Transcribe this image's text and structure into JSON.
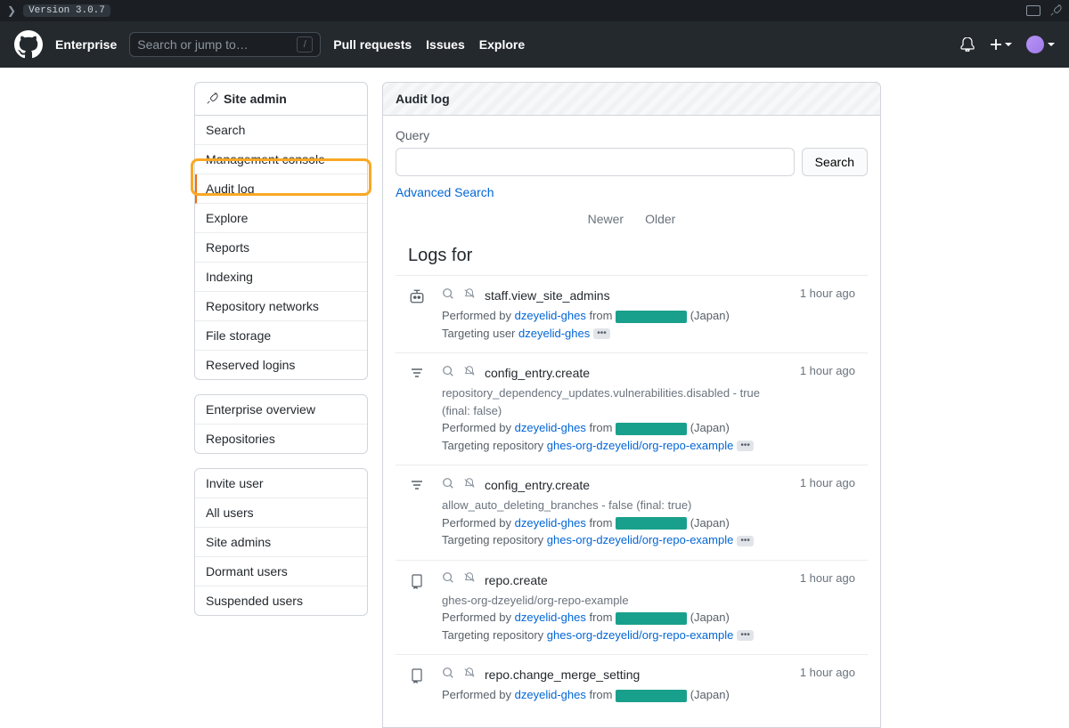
{
  "topbar": {
    "version": "Version 3.0.7"
  },
  "header": {
    "brand": "Enterprise",
    "search_placeholder": "Search or jump to…",
    "nav": {
      "pulls": "Pull requests",
      "issues": "Issues",
      "explore": "Explore"
    }
  },
  "sidebar": {
    "group1": {
      "title": "Site admin",
      "items": [
        "Search",
        "Management console",
        "Audit log",
        "Explore",
        "Reports",
        "Indexing",
        "Repository networks",
        "File storage",
        "Reserved logins"
      ],
      "selected_index": 2
    },
    "group2": {
      "items": [
        "Enterprise overview",
        "Repositories"
      ]
    },
    "group3": {
      "items": [
        "Invite user",
        "All users",
        "Site admins",
        "Dormant users",
        "Suspended users"
      ]
    }
  },
  "content": {
    "title": "Audit log",
    "query_label": "Query",
    "search_btn": "Search",
    "advanced": "Advanced Search",
    "pager": {
      "newer": "Newer",
      "older": "Older"
    },
    "logs_heading": "Logs for"
  },
  "logs": [
    {
      "icon": "robot",
      "action": "staff.view_site_admins",
      "meta": "",
      "performed_prefix": "Performed by ",
      "actor": "dzeyelid-ghes",
      "from": " from ",
      "location": " (Japan)",
      "target_prefix": "Targeting user ",
      "target": "dzeyelid-ghes",
      "time": "1 hour ago"
    },
    {
      "icon": "filter",
      "action": "config_entry.create",
      "meta": "repository_dependency_updates.vulnerabilities.disabled - true (final: false)",
      "performed_prefix": "Performed by ",
      "actor": "dzeyelid-ghes",
      "from": " from ",
      "location": " (Japan)",
      "target_prefix": "Targeting repository ",
      "target": "ghes-org-dzeyelid/org-repo-example",
      "time": "1 hour ago"
    },
    {
      "icon": "filter",
      "action": "config_entry.create",
      "meta": "allow_auto_deleting_branches - false (final: true)",
      "performed_prefix": "Performed by ",
      "actor": "dzeyelid-ghes",
      "from": " from ",
      "location": " (Japan)",
      "target_prefix": "Targeting repository ",
      "target": "ghes-org-dzeyelid/org-repo-example",
      "time": "1 hour ago"
    },
    {
      "icon": "repo",
      "action": "repo.create",
      "meta": "ghes-org-dzeyelid/org-repo-example",
      "performed_prefix": "Performed by ",
      "actor": "dzeyelid-ghes",
      "from": " from ",
      "location": " (Japan)",
      "target_prefix": "Targeting repository ",
      "target": "ghes-org-dzeyelid/org-repo-example",
      "time": "1 hour ago"
    },
    {
      "icon": "repo",
      "action": "repo.change_merge_setting",
      "meta": "",
      "performed_prefix": "Performed by ",
      "actor": "dzeyelid-ghes",
      "from": " from ",
      "location": " (Japan)",
      "target_prefix": "",
      "target": "",
      "time": "1 hour ago"
    }
  ]
}
